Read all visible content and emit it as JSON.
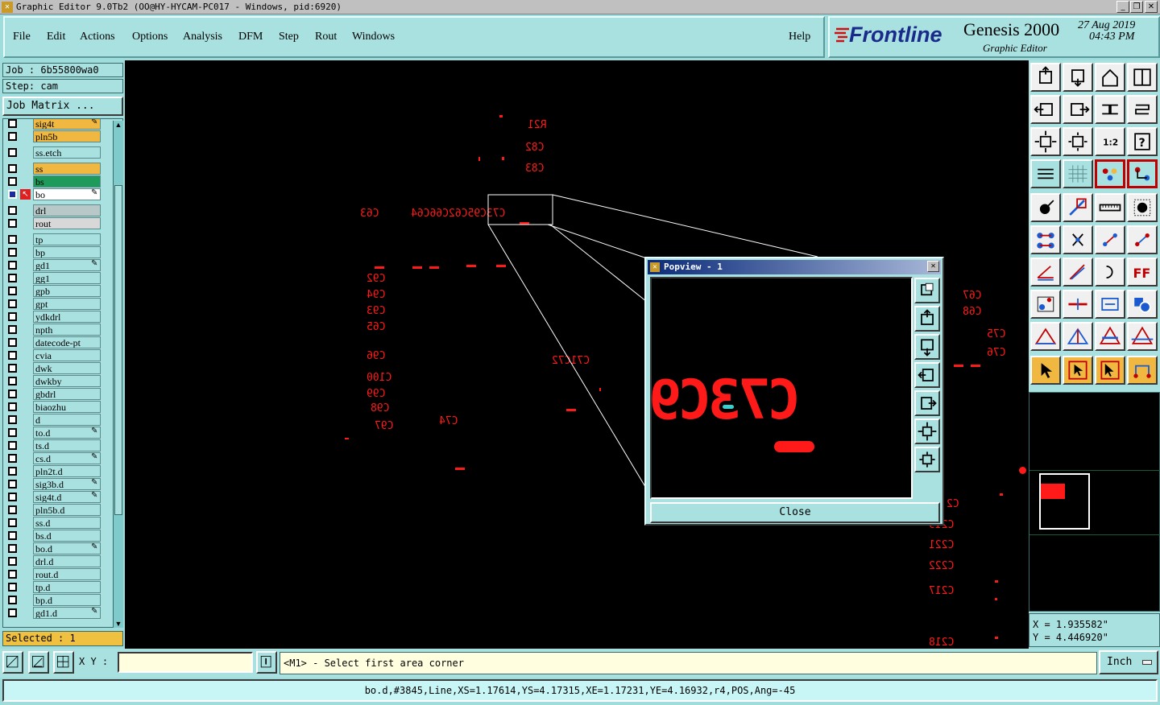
{
  "window": {
    "title": "Graphic Editor 9.0Tb2 (OO@HY-HYCAM-PC017 - Windows, pid:6920)"
  },
  "menu": {
    "items": [
      "File",
      "Edit",
      "Actions",
      "Options",
      "Analysis",
      "DFM",
      "Step",
      "Rout",
      "Windows"
    ],
    "help": "Help"
  },
  "branding": {
    "logo": "Frontline",
    "product": "Genesis 2000",
    "subtitle": "Graphic Editor",
    "date": "27 Aug 2019",
    "time": "04:43 PM"
  },
  "job": {
    "job_label": "Job : 6b55800wa0",
    "step_label": "Step: cam",
    "matrix_button": "Job Matrix ..."
  },
  "layers": [
    {
      "name": "sig4t",
      "color": "#f0b840",
      "mark": "✎"
    },
    {
      "name": "pln5b",
      "color": "#f0b840",
      "mark": ""
    },
    {
      "name": "ss.etch",
      "color": "#a9e0e0",
      "mark": ""
    },
    {
      "name": "ss",
      "color": "#f0b840",
      "mark": ""
    },
    {
      "name": "bs",
      "color": "#1e9a5a",
      "mark": ""
    },
    {
      "name": "bo",
      "color": "#ffffff",
      "mark": "✎"
    },
    {
      "name": "drl",
      "color": "#b8c8c8",
      "mark": ""
    },
    {
      "name": "rout",
      "color": "#d8d8d8",
      "mark": ""
    },
    {
      "name": "tp",
      "color": "#a9e0e0",
      "mark": ""
    },
    {
      "name": "bp",
      "color": "#a9e0e0",
      "mark": ""
    },
    {
      "name": "gd1",
      "color": "#a9e0e0",
      "mark": "✎"
    },
    {
      "name": "gg1",
      "color": "#a9e0e0",
      "mark": ""
    },
    {
      "name": "gpb",
      "color": "#a9e0e0",
      "mark": ""
    },
    {
      "name": "gpt",
      "color": "#a9e0e0",
      "mark": ""
    },
    {
      "name": "ydkdrl",
      "color": "#a9e0e0",
      "mark": ""
    },
    {
      "name": "npth",
      "color": "#a9e0e0",
      "mark": ""
    },
    {
      "name": "datecode-pt",
      "color": "#a9e0e0",
      "mark": ""
    },
    {
      "name": "cvia",
      "color": "#a9e0e0",
      "mark": ""
    },
    {
      "name": "dwk",
      "color": "#a9e0e0",
      "mark": ""
    },
    {
      "name": "dwkby",
      "color": "#a9e0e0",
      "mark": ""
    },
    {
      "name": "gbdrl",
      "color": "#a9e0e0",
      "mark": ""
    },
    {
      "name": "biaozhu",
      "color": "#a9e0e0",
      "mark": ""
    },
    {
      "name": "d",
      "color": "#a9e0e0",
      "mark": ""
    },
    {
      "name": "to.d",
      "color": "#a9e0e0",
      "mark": "✎"
    },
    {
      "name": "ts.d",
      "color": "#a9e0e0",
      "mark": ""
    },
    {
      "name": "cs.d",
      "color": "#a9e0e0",
      "mark": "✎"
    },
    {
      "name": "pln2t.d",
      "color": "#a9e0e0",
      "mark": ""
    },
    {
      "name": "sig3b.d",
      "color": "#a9e0e0",
      "mark": "✎"
    },
    {
      "name": "sig4t.d",
      "color": "#a9e0e0",
      "mark": "✎"
    },
    {
      "name": "pln5b.d",
      "color": "#a9e0e0",
      "mark": ""
    },
    {
      "name": "ss.d",
      "color": "#a9e0e0",
      "mark": ""
    },
    {
      "name": "bs.d",
      "color": "#a9e0e0",
      "mark": ""
    },
    {
      "name": "bo.d",
      "color": "#a9e0e0",
      "mark": "✎"
    },
    {
      "name": "drl.d",
      "color": "#a9e0e0",
      "mark": ""
    },
    {
      "name": "rout.d",
      "color": "#a9e0e0",
      "mark": ""
    },
    {
      "name": "tp.d",
      "color": "#a9e0e0",
      "mark": ""
    },
    {
      "name": "bp.d",
      "color": "#a9e0e0",
      "mark": ""
    },
    {
      "name": "gd1.d",
      "color": "#a9e0e0",
      "mark": "✎"
    }
  ],
  "selected_label": "Selected : 1",
  "canvas_labels": [
    "R21",
    "C82",
    "C83",
    "C73C95C62C66C64",
    "C63",
    "C92",
    "C94",
    "C93",
    "C65",
    "C96",
    "C100",
    "C99",
    "C98",
    "C97",
    "C74",
    "C71C72",
    "C67",
    "C68",
    "C75",
    "C76",
    "C2",
    "C219",
    "C221",
    "C222",
    "C217",
    "C218"
  ],
  "popview": {
    "title": "Popview - 1",
    "close_label": "Close",
    "content_text": "C73C9"
  },
  "coordinates": {
    "x": "X = 1.935582\"",
    "y": "Y = 4.446920\""
  },
  "bottom": {
    "xy_label": "X Y :",
    "xy_value": "",
    "prompt": "<M1> - Select first area corner",
    "unit": "Inch"
  },
  "status": "bo.d,#3845,Line,XS=1.17614,YS=4.17315,XE=1.17231,YE=4.16932,r4,POS,Ang=-45",
  "colors": {
    "panel": "#a9e0e0",
    "canvas": "#000000",
    "feature": "#ff1a1a",
    "highlight": "#f0b840",
    "selection": "#3ad0d0"
  }
}
